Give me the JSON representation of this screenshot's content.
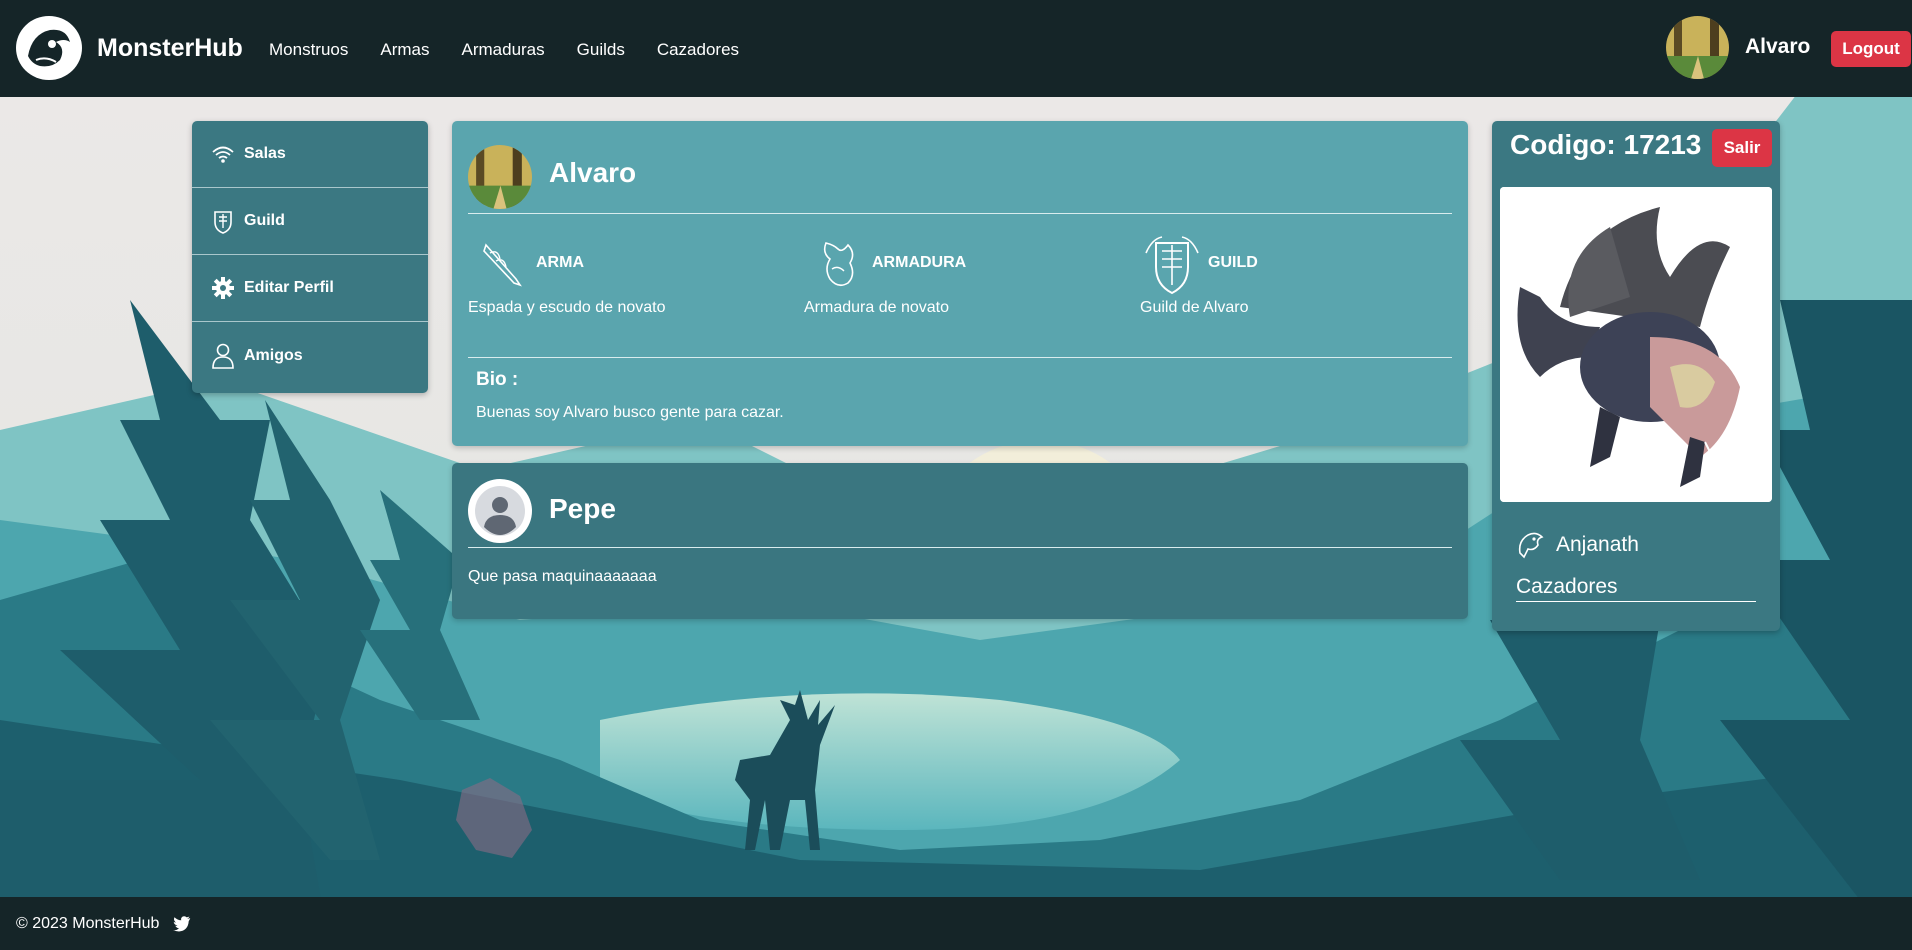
{
  "navbar": {
    "brand": "MonsterHub",
    "links": [
      "Monstruos",
      "Armas",
      "Armaduras",
      "Guilds",
      "Cazadores"
    ],
    "user_name": "Alvaro",
    "logout_label": "Logout"
  },
  "sidebar": {
    "items": [
      {
        "label": "Salas",
        "icon": "wifi-icon"
      },
      {
        "label": "Guild",
        "icon": "guild-crest-icon"
      },
      {
        "label": "Editar Perfil",
        "icon": "gear-icon"
      },
      {
        "label": "Amigos",
        "icon": "person-icon"
      }
    ]
  },
  "profile": {
    "name": "Alvaro",
    "stats": [
      {
        "title": "ARMA",
        "value": "Espada y escudo de novato",
        "icon": "sword-icon"
      },
      {
        "title": "ARMADURA",
        "value": "Armadura de novato",
        "icon": "armor-icon"
      },
      {
        "title": "GUILD",
        "value": "Guild de Alvaro",
        "icon": "guild-crest-icon"
      }
    ],
    "bio_label": "Bio :",
    "bio_text": "Buenas soy Alvaro busco gente para cazar."
  },
  "friend_post": {
    "name": "Pepe",
    "message": "Que pasa maquinaaaaaaa"
  },
  "room": {
    "code_label": "Codigo: 17213",
    "exit_label": "Salir",
    "monster_name": "Anjanath",
    "link_label": "Cazadores"
  },
  "footer": {
    "text": "© 2023 MonsterHub"
  },
  "colors": {
    "navbar": "#152528",
    "card_light": "#5aa5ae",
    "card_dark": "#3b7882",
    "danger": "#dc3545"
  }
}
